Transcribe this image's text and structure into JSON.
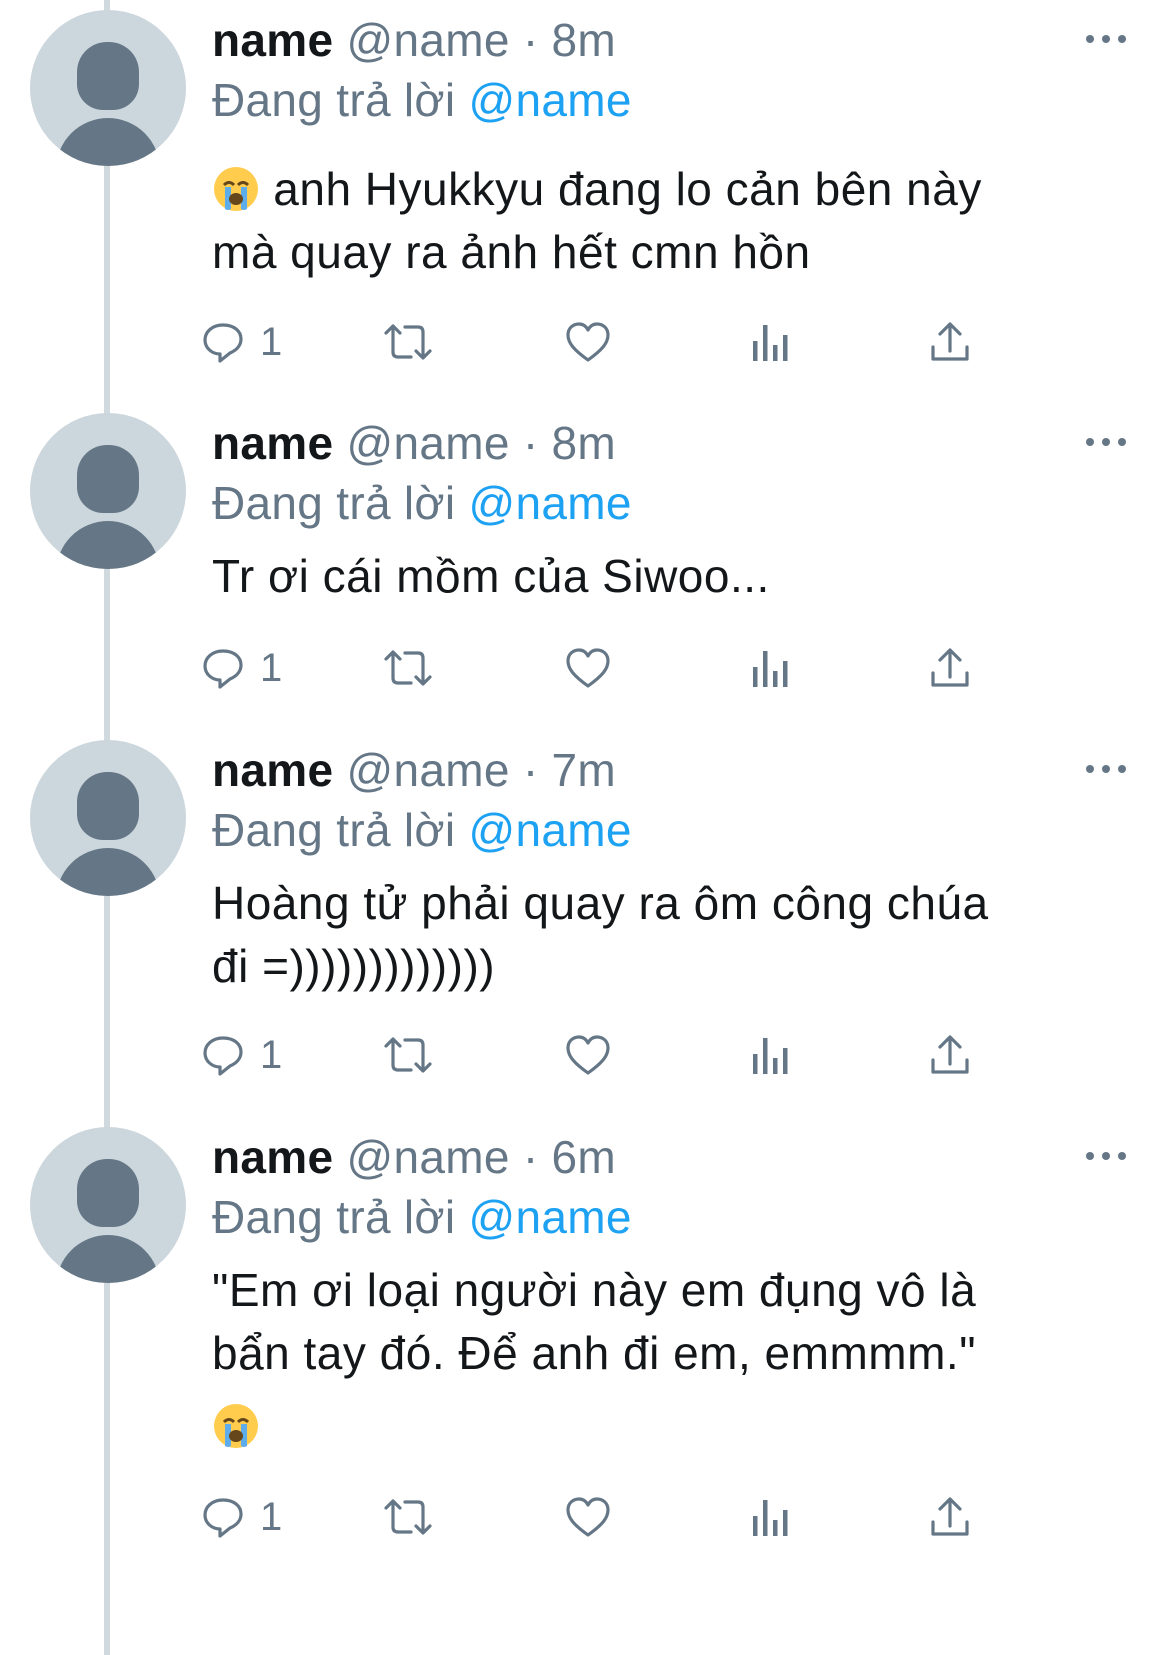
{
  "colors": {
    "link": "#1da1f2",
    "secondary": "#657786",
    "avatar_bg": "#ccd6dd",
    "thread_line": "#cfd9de"
  },
  "icons": {
    "more": "more-options-icon",
    "reply": "reply-icon",
    "retweet": "retweet-icon",
    "like": "heart-icon",
    "analytics": "analytics-icon",
    "share": "share-icon",
    "emoji": "loudly-crying-face-emoji"
  },
  "tweets": [
    {
      "display_name": "name",
      "handle": "@name",
      "separator": "·",
      "time": "8m",
      "reply_prefix": "Đang trả lời",
      "reply_to": "@name",
      "lines": [
        "anh Hyukkyu đang lo cản bên này",
        "mà quay ra ảnh hết cmn hồn"
      ],
      "emoji_lead": "😭",
      "reply_count": "1"
    },
    {
      "display_name": "name",
      "handle": "@name",
      "separator": "·",
      "time": "8m",
      "reply_prefix": "Đang trả lời",
      "reply_to": "@name",
      "lines": [
        "Tr ơi cái mồm của Siwoo..."
      ],
      "reply_count": "1"
    },
    {
      "display_name": "name",
      "handle": "@name",
      "separator": "·",
      "time": "7m",
      "reply_prefix": "Đang trả lời",
      "reply_to": "@name",
      "lines": [
        "Hoàng tử phải quay ra ôm công chúa",
        "đi =)))))))))))))"
      ],
      "reply_count": "1"
    },
    {
      "display_name": "name",
      "handle": "@name",
      "separator": "·",
      "time": "6m",
      "reply_prefix": "Đang trả lời",
      "reply_to": "@name",
      "lines": [
        "\"Em ơi loại người này em đụng vô là",
        "bẩn tay đó. Để anh đi em, emmmm.\""
      ],
      "emoji_trail": "😭",
      "reply_count": "1"
    }
  ]
}
